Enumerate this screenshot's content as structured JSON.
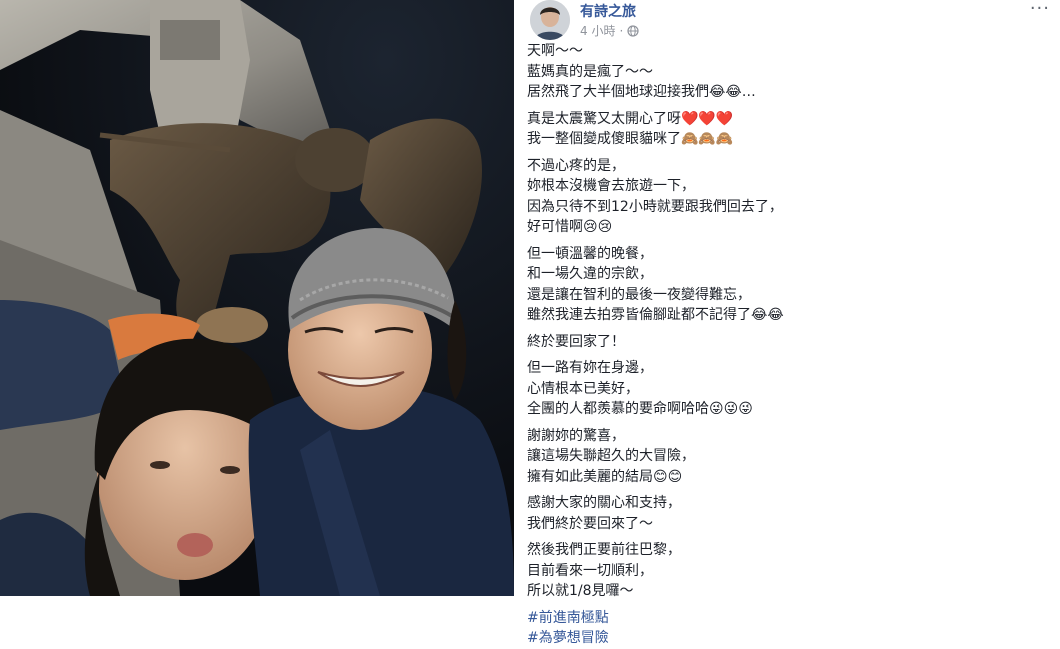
{
  "post": {
    "author": "有詩之旅",
    "time": "4 小時",
    "privacy_icon": "globe-icon",
    "more_icon": "more-icon",
    "more_label": "···",
    "paragraphs": [
      [
        "天啊～～",
        "藍媽真的是瘋了～～",
        "居然飛了大半個地球迎接我們😂😂…"
      ],
      [
        "真是太震驚又太開心了呀❤️❤️❤️",
        "我一整個變成傻眼貓咪了🙈🙈🙈"
      ],
      [
        "不過心疼的是，",
        "妳根本沒機會去旅遊一下，",
        "因為只待不到12小時就要跟我們回去了，",
        "好可惜啊😢😢"
      ],
      [
        "但一頓溫馨的晚餐，",
        "和一場久違的宗飲，",
        "還是讓在智利的最後一夜變得難忘，",
        "雖然我連去拍雰皆倫腳趾都不記得了😂😂"
      ],
      [
        "終於要回家了！"
      ],
      [
        "但一路有妳在身邊，",
        "心情根本已美好，",
        "全團的人都羨慕的要命啊哈哈😜😜😜"
      ],
      [
        "謝謝妳的驚喜，",
        "讓這場失聯超久的大冒險，",
        "擁有如此美麗的結局😊😊"
      ],
      [
        "感謝大家的關心和支持，",
        "我們終於要回來了～"
      ],
      [
        "然後我們正要前往巴黎，",
        "目前看來一切順利，",
        "所以就1/8見囉～"
      ]
    ],
    "hashtags": [
      "#前進南極點",
      "#為夢想冒險"
    ]
  }
}
